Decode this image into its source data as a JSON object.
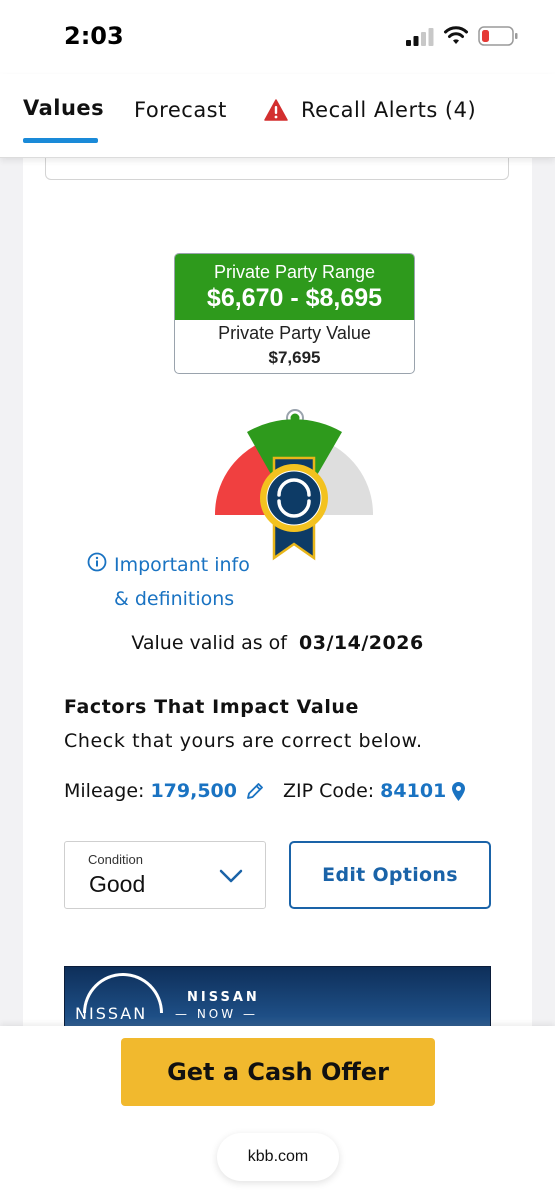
{
  "status_bar": {
    "time": "2:03",
    "signal_icon": "cell-signal-icon",
    "wifi_icon": "wifi-icon",
    "battery_icon": "battery-low-icon",
    "battery_color": "#e53935"
  },
  "tabs": [
    {
      "label": "Values",
      "active": true
    },
    {
      "label": "Forecast",
      "active": false
    },
    {
      "label": "Recall Alerts (4)",
      "active": false,
      "icon": "warning-icon"
    }
  ],
  "valuation": {
    "range_label": "Private Party Range",
    "range_value": "$6,670 - $8,695",
    "value_label": "Private Party Value",
    "value": "$7,695",
    "range_color": "#2e9a1c"
  },
  "info_link": {
    "line1": "Important info",
    "line2": "& definitions",
    "icon": "info-icon"
  },
  "valid": {
    "prefix": "Value valid as of",
    "date": "03/14/2026"
  },
  "factors": {
    "title": "Factors That Impact Value",
    "subtitle": "Check that yours are correct below.",
    "mileage_label": "Mileage:",
    "mileage_value": "179,500",
    "zip_label": "ZIP Code:",
    "zip_value": "84101"
  },
  "condition": {
    "label": "Condition",
    "value": "Good"
  },
  "edit_options_label": "Edit Options",
  "ad": {
    "brand": "NISSAN",
    "title": "NISSAN",
    "subtitle": "NOW"
  },
  "cta_label": "Get a Cash Offer",
  "url": "kbb.com",
  "accent_color": "#1a73c2",
  "cta_color": "#f1b92e"
}
